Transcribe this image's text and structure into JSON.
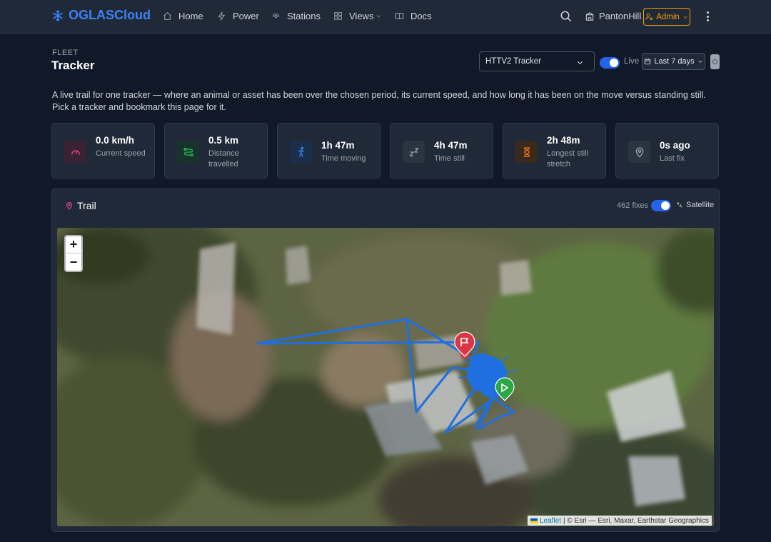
{
  "nav": {
    "brand": "OGLASCloud",
    "items": [
      {
        "label": "Home",
        "icon": "home-icon"
      },
      {
        "label": "Power",
        "icon": "bolt-icon"
      },
      {
        "label": "Stations",
        "icon": "broadcast-icon"
      },
      {
        "label": "Views",
        "icon": "grid-icon"
      },
      {
        "label": "Docs",
        "icon": "book-icon"
      }
    ],
    "station": "PantonHill",
    "admin_label": "Admin"
  },
  "header": {
    "eyebrow": "FLEET",
    "title": "Tracker",
    "tracker_selected": "HTTV2 Tracker",
    "live_label": "Live",
    "live_on": true,
    "range_label": "Last 7 days",
    "description": "A live trail for one tracker — where an animal or asset has been over the chosen period, its current speed, and how long it has been on the move versus standing still. Pick a tracker and bookmark this page for it."
  },
  "stats": [
    {
      "value": "0.0 km/h",
      "label": "Current speed",
      "icon": "speedometer-icon",
      "color": "#ec4899"
    },
    {
      "value": "0.5 km",
      "label": "Distance travelled",
      "icon": "route-icon",
      "color": "#22c55e"
    },
    {
      "value": "1h 47m",
      "label": "Time moving",
      "icon": "running-icon",
      "color": "#3b82f6"
    },
    {
      "value": "4h 47m",
      "label": "Time still",
      "icon": "sleep-icon",
      "color": "#9ca3af"
    },
    {
      "value": "2h 48m",
      "label": "Longest still stretch",
      "icon": "hourglass-icon",
      "color": "#f97316"
    },
    {
      "value": "0s ago",
      "label": "Last fix",
      "icon": "pin-icon",
      "color": "#9ca3af"
    }
  ],
  "trail": {
    "title": "Trail",
    "fixes": "462 fixes",
    "satellite_label": "Satellite",
    "satellite_on": true,
    "zoom_in": "+",
    "zoom_out": "−",
    "attribution_link": "Leaflet",
    "attribution_text": "| © Esri — Esri, Maxar, Earthstar Geographics",
    "trail_color": "#1f6fe0"
  }
}
